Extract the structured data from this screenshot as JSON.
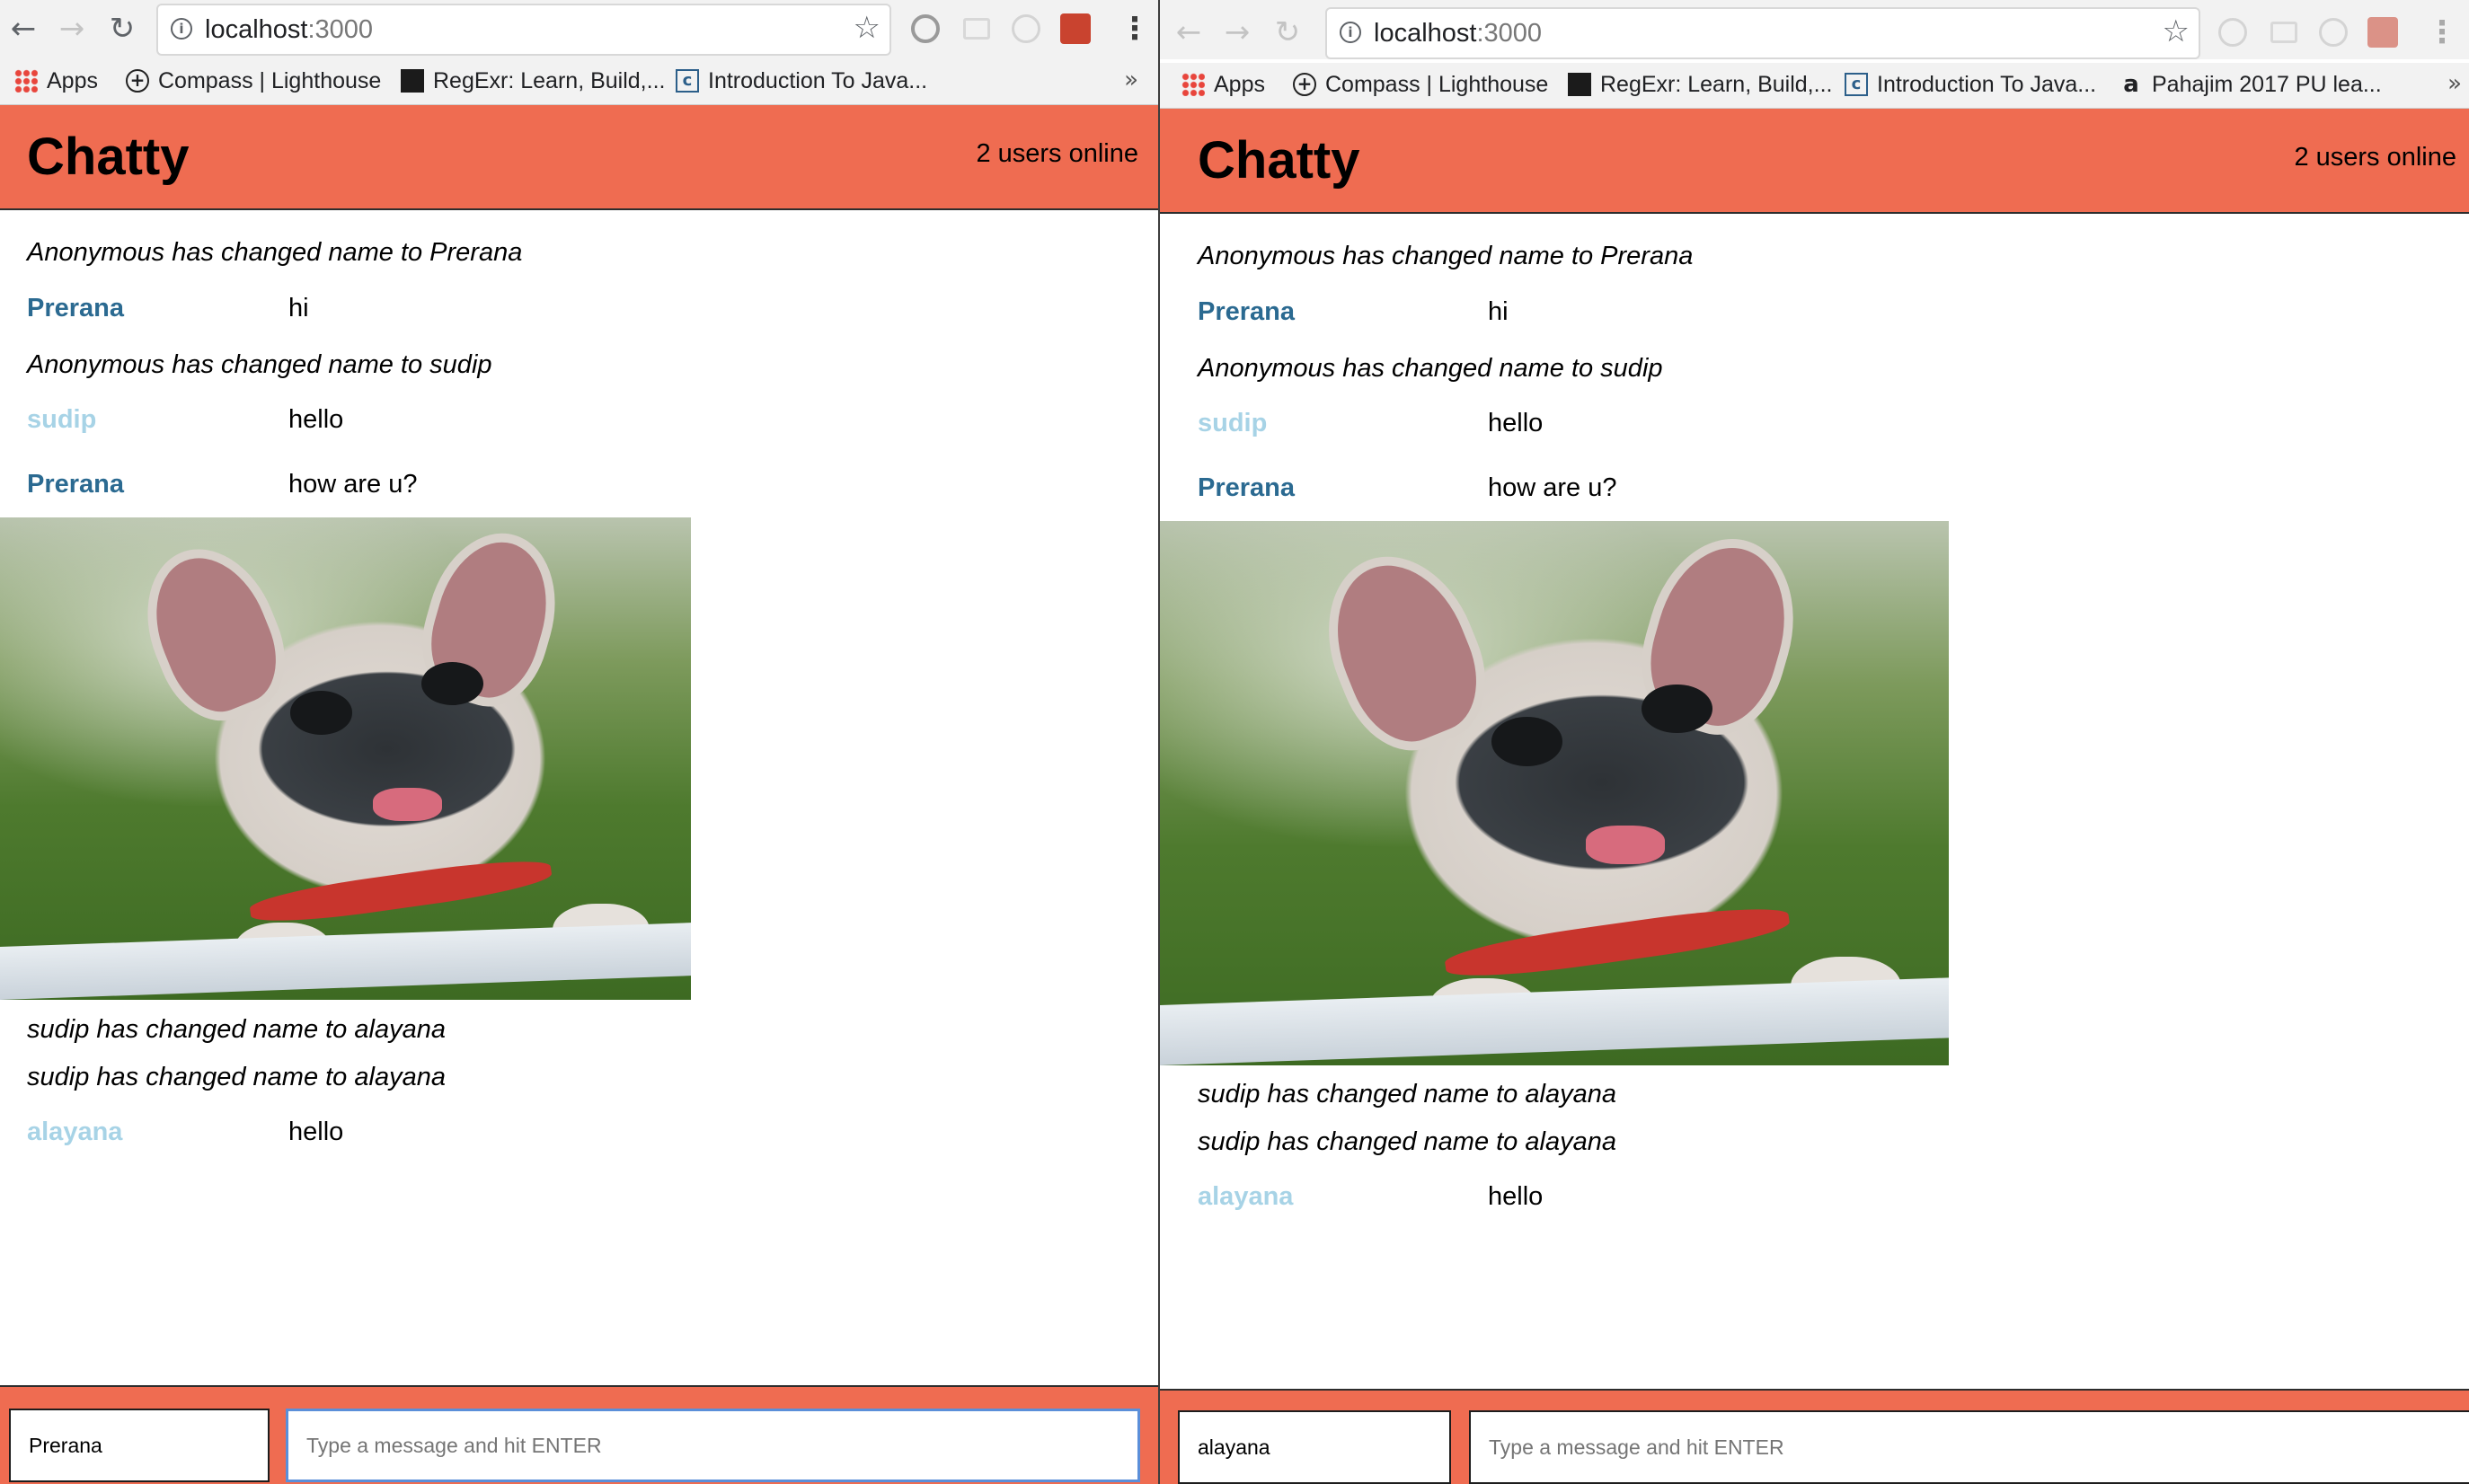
{
  "windows": [
    {
      "url_host": "localhost",
      "url_port": ":3000",
      "bookmarks": [
        "Apps",
        "Compass | Lighthouse",
        "RegExr: Learn, Build,...",
        "Introduction To Java..."
      ],
      "app": {
        "title": "Chatty",
        "users_online": "2 users online",
        "messages": [
          {
            "type": "notice",
            "text": "Anonymous has changed name to Prerana"
          },
          {
            "type": "message",
            "user": "Prerana",
            "text": "hi",
            "user_color": "#2b6a91"
          },
          {
            "type": "notice",
            "text": "Anonymous has changed name to sudip"
          },
          {
            "type": "message",
            "user": "sudip",
            "text": "hello",
            "user_color": "#a7d3e6"
          },
          {
            "type": "message",
            "user": "Prerana",
            "text": "how are u?",
            "user_color": "#2b6a91"
          },
          {
            "type": "image",
            "description_icon": "french-bulldog-photo"
          },
          {
            "type": "notice",
            "text": "sudip has changed name to alayana"
          },
          {
            "type": "notice",
            "text": "sudip has changed name to alayana"
          },
          {
            "type": "message",
            "user": "alayana",
            "text": "hello",
            "user_color": "#a7d3e6"
          }
        ],
        "footer": {
          "username_value": "Prerana",
          "message_placeholder": "Type a message and hit ENTER",
          "message_value": ""
        }
      }
    },
    {
      "url_host": "localhost",
      "url_port": ":3000",
      "bookmarks": [
        "Apps",
        "Compass | Lighthouse",
        "RegExr: Learn, Build,...",
        "Introduction To Java...",
        "Pahajim 2017 PU lea..."
      ],
      "app": {
        "title": "Chatty",
        "users_online": "2 users online",
        "messages": [
          {
            "type": "notice",
            "text": "Anonymous has changed name to Prerana"
          },
          {
            "type": "message",
            "user": "Prerana",
            "text": "hi",
            "user_color": "#2b6a91"
          },
          {
            "type": "notice",
            "text": "Anonymous has changed name to sudip"
          },
          {
            "type": "message",
            "user": "sudip",
            "text": "hello",
            "user_color": "#a7d3e6"
          },
          {
            "type": "message",
            "user": "Prerana",
            "text": "how are u?",
            "user_color": "#2b6a91"
          },
          {
            "type": "image",
            "description_icon": "french-bulldog-photo"
          },
          {
            "type": "notice",
            "text": "sudip has changed name to alayana"
          },
          {
            "type": "notice",
            "text": "sudip has changed name to alayana"
          },
          {
            "type": "message",
            "user": "alayana",
            "text": "hello",
            "user_color": "#a7d3e6"
          }
        ],
        "footer": {
          "username_value": "alayana",
          "message_placeholder": "Type a message and hit ENTER",
          "message_value": ""
        }
      }
    }
  ],
  "colors": {
    "header_bg": "#ef6c51",
    "focus_ring": "#5b8fd9"
  }
}
